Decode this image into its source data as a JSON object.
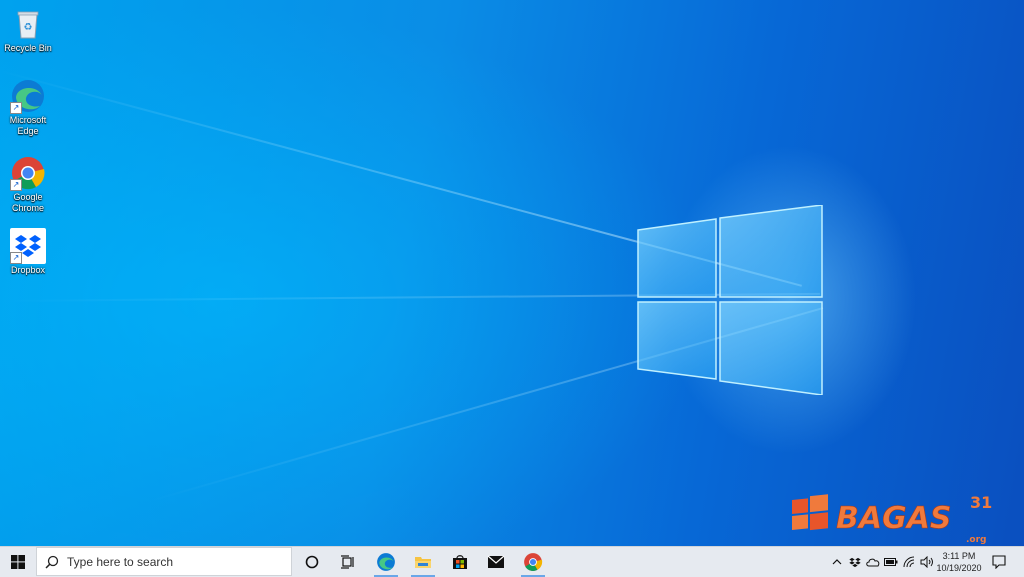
{
  "desktop": {
    "icons": [
      {
        "label": "Recycle Bin",
        "icon": "recycle-bin-icon"
      },
      {
        "label": "Microsoft Edge",
        "icon": "edge-icon"
      },
      {
        "label": "Google Chrome",
        "icon": "chrome-icon"
      },
      {
        "label": "Dropbox",
        "icon": "dropbox-icon"
      }
    ]
  },
  "watermark": {
    "brand": "BAGAS",
    "number": "31",
    "suffix": ".org"
  },
  "taskbar": {
    "search": {
      "placeholder": "Type here to search"
    },
    "apps": [
      {
        "name": "cortana",
        "icon": "cortana-icon"
      },
      {
        "name": "task-view",
        "icon": "task-view-icon"
      },
      {
        "name": "edge",
        "icon": "edge-icon"
      },
      {
        "name": "file-explorer",
        "icon": "folder-icon"
      },
      {
        "name": "store",
        "icon": "store-icon"
      },
      {
        "name": "mail",
        "icon": "mail-icon"
      },
      {
        "name": "chrome",
        "icon": "chrome-icon"
      }
    ],
    "tray": {
      "icons": [
        "chevron-up-icon",
        "dropbox-icon",
        "onedrive-icon",
        "battery-icon",
        "wifi-icon",
        "volume-icon"
      ],
      "time": "3:11 PM",
      "date": "10/19/2020"
    }
  },
  "colors": {
    "accent": "#0078d7",
    "taskbar_bg": "#e6eaf0",
    "wallpaper": "#0a8de6"
  }
}
